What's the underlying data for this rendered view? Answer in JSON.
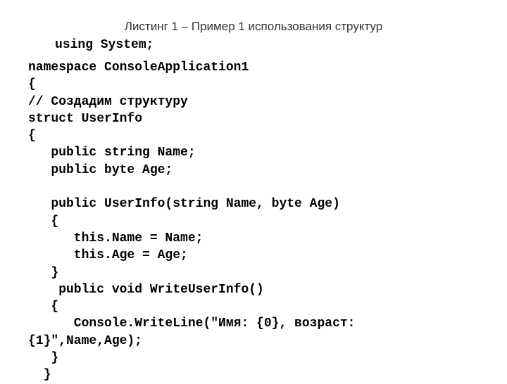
{
  "caption": "Листинг 1 – Пример 1 использования структур",
  "usingLine": "using System;",
  "code": {
    "l01": "namespace ConsoleApplication1",
    "l02": "{",
    "l03": "// Создадим структуру",
    "l04": "struct UserInfo",
    "l05": "{",
    "l06": "   public string Name;",
    "l07": "   public byte Age;",
    "l08": "",
    "l09": "   public UserInfo(string Name, byte Age)",
    "l10": "   {",
    "l11": "      this.Name = Name;",
    "l12": "      this.Age = Age;",
    "l13": "   }",
    "l14": "    public void WriteUserInfo()",
    "l15": "   {",
    "l16": "      Console.WriteLine(\"Имя: {0}, возраст:",
    "l17": "{1}\",Name,Age);",
    "l18": "   }",
    "l19": "  }"
  }
}
